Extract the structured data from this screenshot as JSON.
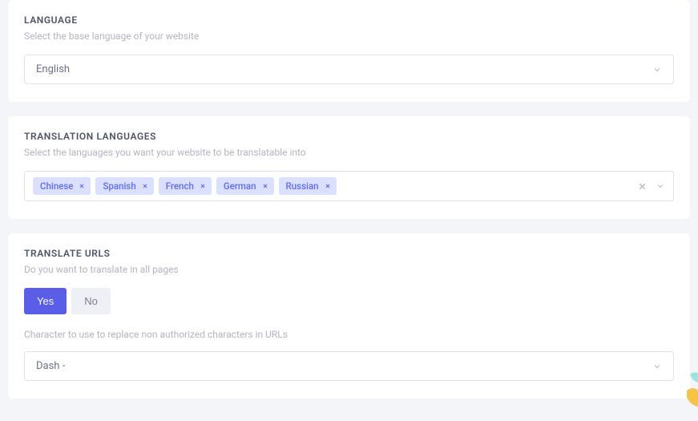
{
  "language_card": {
    "title": "LANGUAGE",
    "desc": "Select the base language of your website",
    "selected": "English"
  },
  "translation_card": {
    "title": "TRANSLATION LANGUAGES",
    "desc": "Select the languages you want your website to be translatable into",
    "tags": [
      "Chinese",
      "Spanish",
      "French",
      "German",
      "Russian"
    ]
  },
  "urls_card": {
    "title": "TRANSLATE URLS",
    "desc": "Do you want to translate in all pages",
    "yes": "Yes",
    "no": "No",
    "char_desc": "Character to use to replace non authorized characters in URLs",
    "char_selected": "Dash -"
  }
}
